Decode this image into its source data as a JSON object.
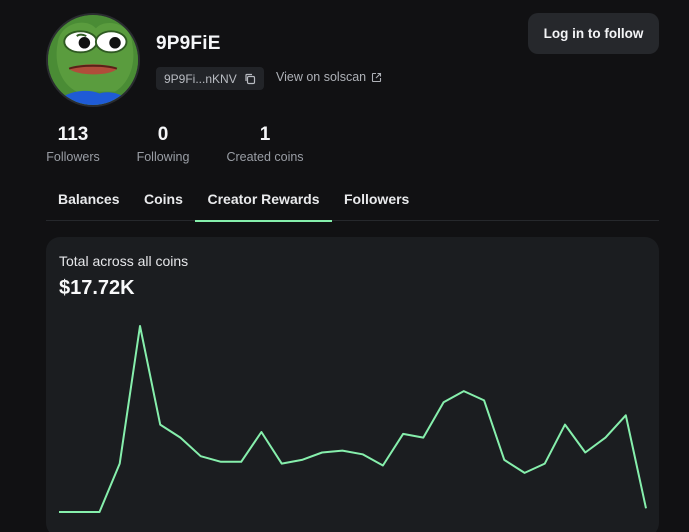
{
  "profile": {
    "username": "9P9FiE",
    "address_short": "9P9Fi...nKNV",
    "solscan_label": "View on solscan",
    "follow_button": "Log in to follow"
  },
  "stats": {
    "followers": {
      "value": "113",
      "label": "Followers"
    },
    "following": {
      "value": "0",
      "label": "Following"
    },
    "created": {
      "value": "1",
      "label": "Created coins"
    }
  },
  "tabs": [
    {
      "label": "Balances"
    },
    {
      "label": "Coins"
    },
    {
      "label": "Creator Rewards",
      "active": true
    },
    {
      "label": "Followers"
    }
  ],
  "rewards": {
    "label": "Total across all coins",
    "total": "$17.72K"
  },
  "colors": {
    "background": "#111113",
    "card": "#1b1d20",
    "accent": "#86efac"
  },
  "icons": {
    "copy": "copy-icon",
    "external": "external-link-icon",
    "avatar": "pepe-frog-avatar"
  },
  "chart_data": {
    "type": "line",
    "title": "",
    "xlabel": "",
    "ylabel": "",
    "grid": false,
    "series": [
      {
        "values": [
          0,
          0,
          0,
          26,
          100,
          47,
          40,
          30,
          27,
          27,
          43,
          26,
          28,
          32,
          33,
          31,
          25,
          42,
          40,
          59,
          65,
          60,
          28,
          21,
          26,
          47,
          32,
          40,
          52,
          2
        ]
      }
    ],
    "ylim": [
      0,
      100
    ]
  }
}
